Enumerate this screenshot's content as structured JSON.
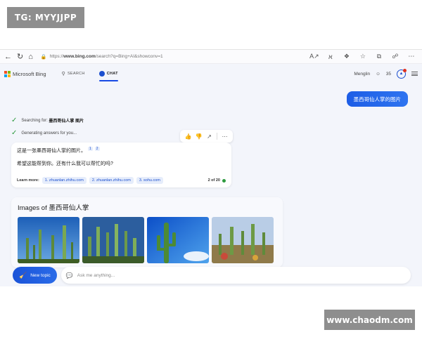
{
  "watermarks": {
    "top": "TG: MYYJJPP",
    "bottom": "www.chaodm.com"
  },
  "browser": {
    "url_prefix": "https://",
    "url_host": "www.bing.com",
    "url_path": "/search?q=Bing+AI&showconv=1"
  },
  "header": {
    "brand": "Microsoft Bing",
    "tabs": [
      {
        "label": "SEARCH",
        "icon": "search-icon"
      },
      {
        "label": "CHAT",
        "icon": "chat-icon"
      }
    ],
    "user_name": "Menglin",
    "points": "35"
  },
  "chat": {
    "user_message": "墨西哥仙人掌的图片",
    "status": [
      {
        "prefix": "Searching for: ",
        "query": "墨西哥仙人掌 图片"
      },
      {
        "prefix": "Generating answers for you...",
        "query": ""
      }
    ],
    "answer": {
      "line1": "这是一张墨西哥仙人掌的图片。",
      "refs": [
        "1",
        "2"
      ],
      "line2": "希望这能帮到你。还有什么我可以帮忙的吗?",
      "learn_more_label": "Learn more:",
      "sources": [
        "1. zhuanlan.zhihu.com",
        "2. zhuanlan.zhihu.com",
        "3. sohu.com"
      ],
      "count": "2 of 20"
    },
    "images": {
      "title": "Images of 墨西哥仙人掌"
    }
  },
  "input": {
    "new_topic_label": "New topic",
    "placeholder": "Ask me anything..."
  },
  "colors": {
    "accent": "#1b4fcf",
    "check": "#2d9a3e",
    "bubble": "#1d5de6"
  }
}
